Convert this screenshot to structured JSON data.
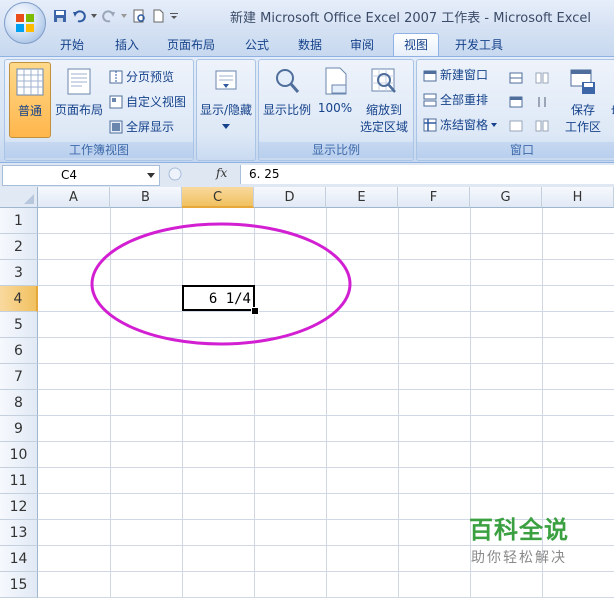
{
  "window": {
    "title": "新建 Microsoft Office Excel 2007 工作表 - Microsoft Excel"
  },
  "tabs": [
    {
      "label": "开始",
      "active": false
    },
    {
      "label": "插入",
      "active": false
    },
    {
      "label": "页面布局",
      "active": false
    },
    {
      "label": "公式",
      "active": false
    },
    {
      "label": "数据",
      "active": false
    },
    {
      "label": "审阅",
      "active": false
    },
    {
      "label": "视图",
      "active": true
    },
    {
      "label": "开发工具",
      "active": false
    }
  ],
  "ribbon": {
    "workbook_views": {
      "label": "工作簿视图",
      "normal": "普通",
      "page_layout": "页面布局",
      "page_break": "分页预览",
      "custom_views": "自定义视图",
      "full_screen": "全屏显示"
    },
    "show_hide": {
      "label": "显示/隐藏"
    },
    "zoom": {
      "label": "显示比例",
      "zoom": "显示比例",
      "hundred": "100%",
      "to_selection_line1": "缩放到",
      "to_selection_line2": "选定区域"
    },
    "window": {
      "label": "窗口",
      "new_window": "新建窗口",
      "arrange_all": "全部重排",
      "freeze_panes": "冻结窗格",
      "save_line1": "保存",
      "save_line2": "工作区",
      "truncated": "切"
    }
  },
  "formula_bar": {
    "name_box": "C4",
    "fx": "fx",
    "value": "6. 25"
  },
  "sheet": {
    "columns": [
      "A",
      "B",
      "C",
      "D",
      "E",
      "F",
      "G",
      "H"
    ],
    "rows": [
      "1",
      "2",
      "3",
      "4",
      "5",
      "6",
      "7",
      "8",
      "9",
      "10",
      "11",
      "12",
      "13",
      "14",
      "15"
    ],
    "active_cell": "C4",
    "active_cell_display": "6 1/4",
    "annotation_color": "#d21fd2"
  },
  "watermark": {
    "title": "百科全说",
    "subtitle": "助你轻松解决"
  }
}
